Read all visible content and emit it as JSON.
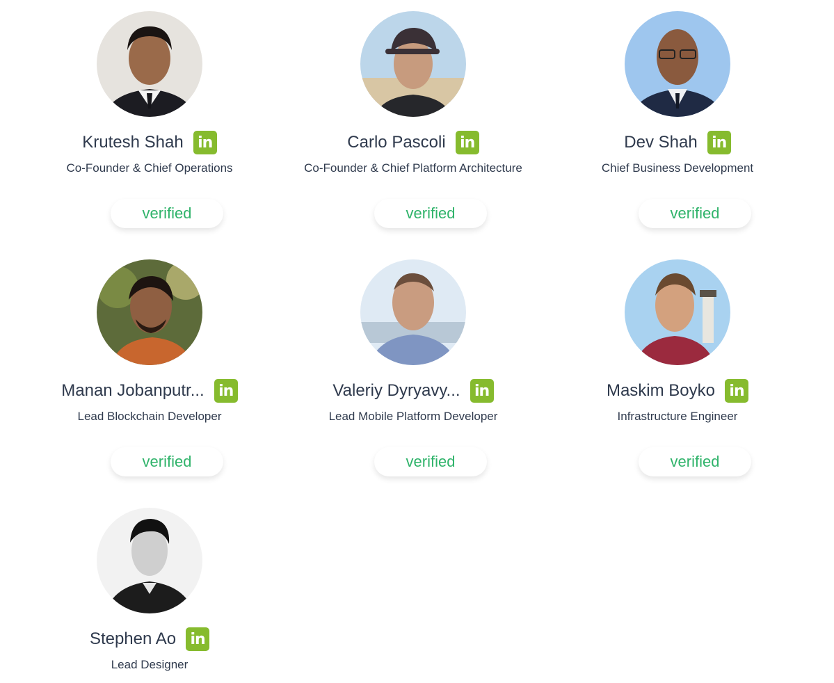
{
  "team": [
    {
      "name": "Krutesh Shah",
      "title": "Co-Founder & Chief Operations",
      "status": "verified",
      "linkedin": "in"
    },
    {
      "name": "Carlo Pascoli",
      "title": "Co-Founder & Chief Platform Architecture",
      "status": "verified",
      "linkedin": "in"
    },
    {
      "name": "Dev Shah",
      "title": "Chief Business Development",
      "status": "verified",
      "linkedin": "in"
    },
    {
      "name": "Manan Jobanputr...",
      "title": "Lead Blockchain Developer",
      "status": "verified",
      "linkedin": "in"
    },
    {
      "name": "Valeriy Dyryavy...",
      "title": "Lead Mobile Platform Developer",
      "status": "verified",
      "linkedin": "in"
    },
    {
      "name": "Maskim Boyko",
      "title": "Infrastructure Engineer",
      "status": "verified",
      "linkedin": "in"
    },
    {
      "name": "Stephen Ao",
      "title": "Lead Designer",
      "linkedin": "in"
    }
  ],
  "colors": {
    "linkedin": "#86bb2e",
    "verified": "#2fb36a",
    "text": "#2f3a4d"
  }
}
